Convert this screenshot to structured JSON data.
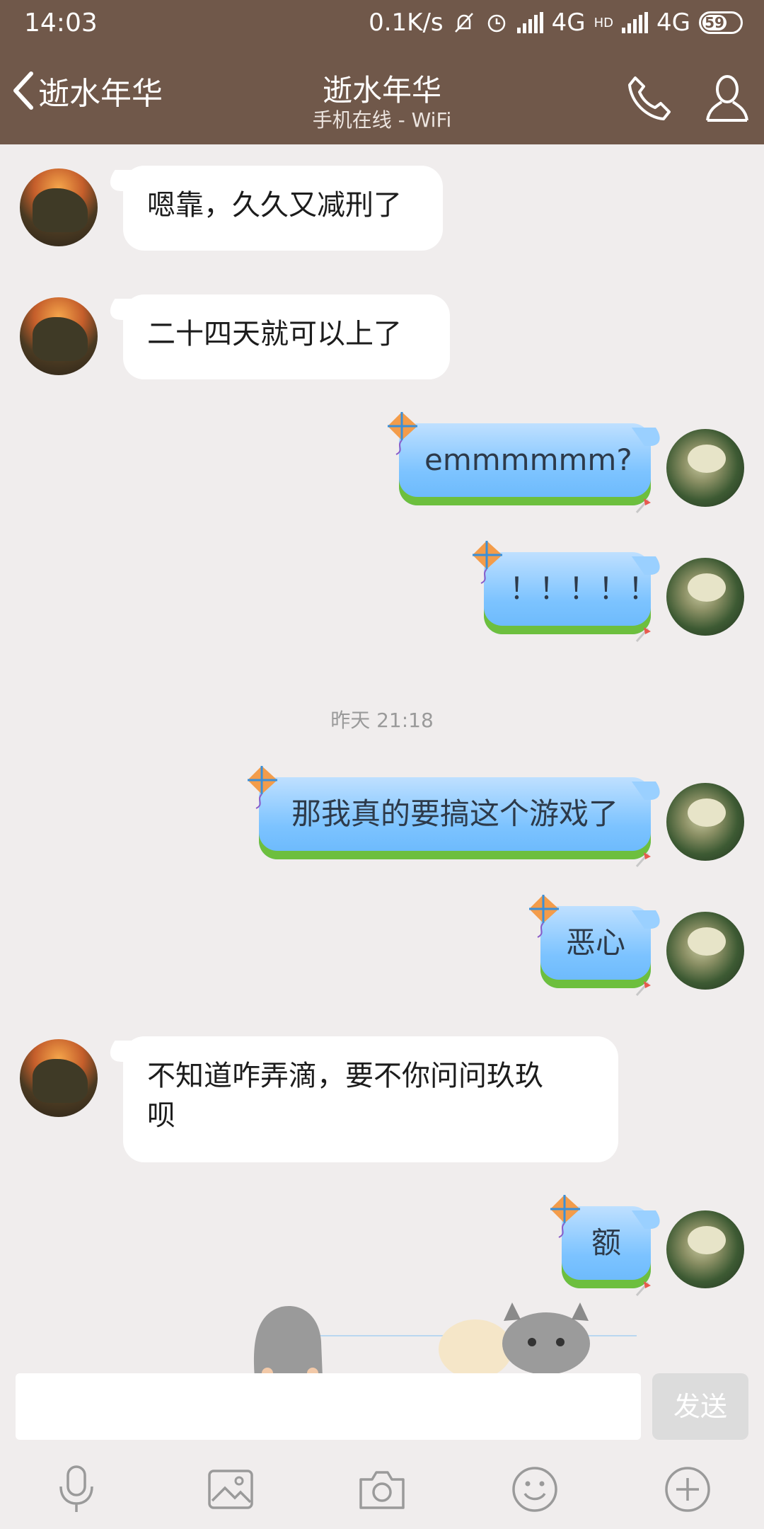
{
  "status_bar": {
    "time": "14:03",
    "speed": "0.1K/s",
    "net1": "4G",
    "net2": "4G",
    "hd": "HD",
    "battery": "59"
  },
  "header": {
    "back_label": "逝水年华",
    "title": "逝水年华",
    "subtitle": "手机在线 - WiFi",
    "icons": [
      "phone-icon",
      "contact-icon"
    ]
  },
  "messages": [
    {
      "side": "left",
      "text": "嗯靠，久久又减刑了"
    },
    {
      "side": "left",
      "text": "二十四天就可以上了"
    },
    {
      "side": "right",
      "text": "emmmmmm?"
    },
    {
      "side": "right",
      "text": "！！！！！"
    },
    {
      "timestamp": "昨天 21:18"
    },
    {
      "side": "right",
      "text": "那我真的要搞这个游戏了"
    },
    {
      "side": "right",
      "text": "恶心"
    },
    {
      "side": "left",
      "text": "不知道咋弄滴，要不你问问玖玖\n呗"
    },
    {
      "side": "right",
      "text": "额"
    }
  ],
  "input": {
    "placeholder": "",
    "send_label": "发送"
  },
  "toolbar": [
    "microphone-icon",
    "image-icon",
    "camera-icon",
    "emoji-icon",
    "plus-icon"
  ],
  "colors": {
    "header_bg": "#70584a",
    "chat_bg": "#f0eded",
    "bubble_in": "#ffffff",
    "bubble_out": "#7cc3ff"
  }
}
